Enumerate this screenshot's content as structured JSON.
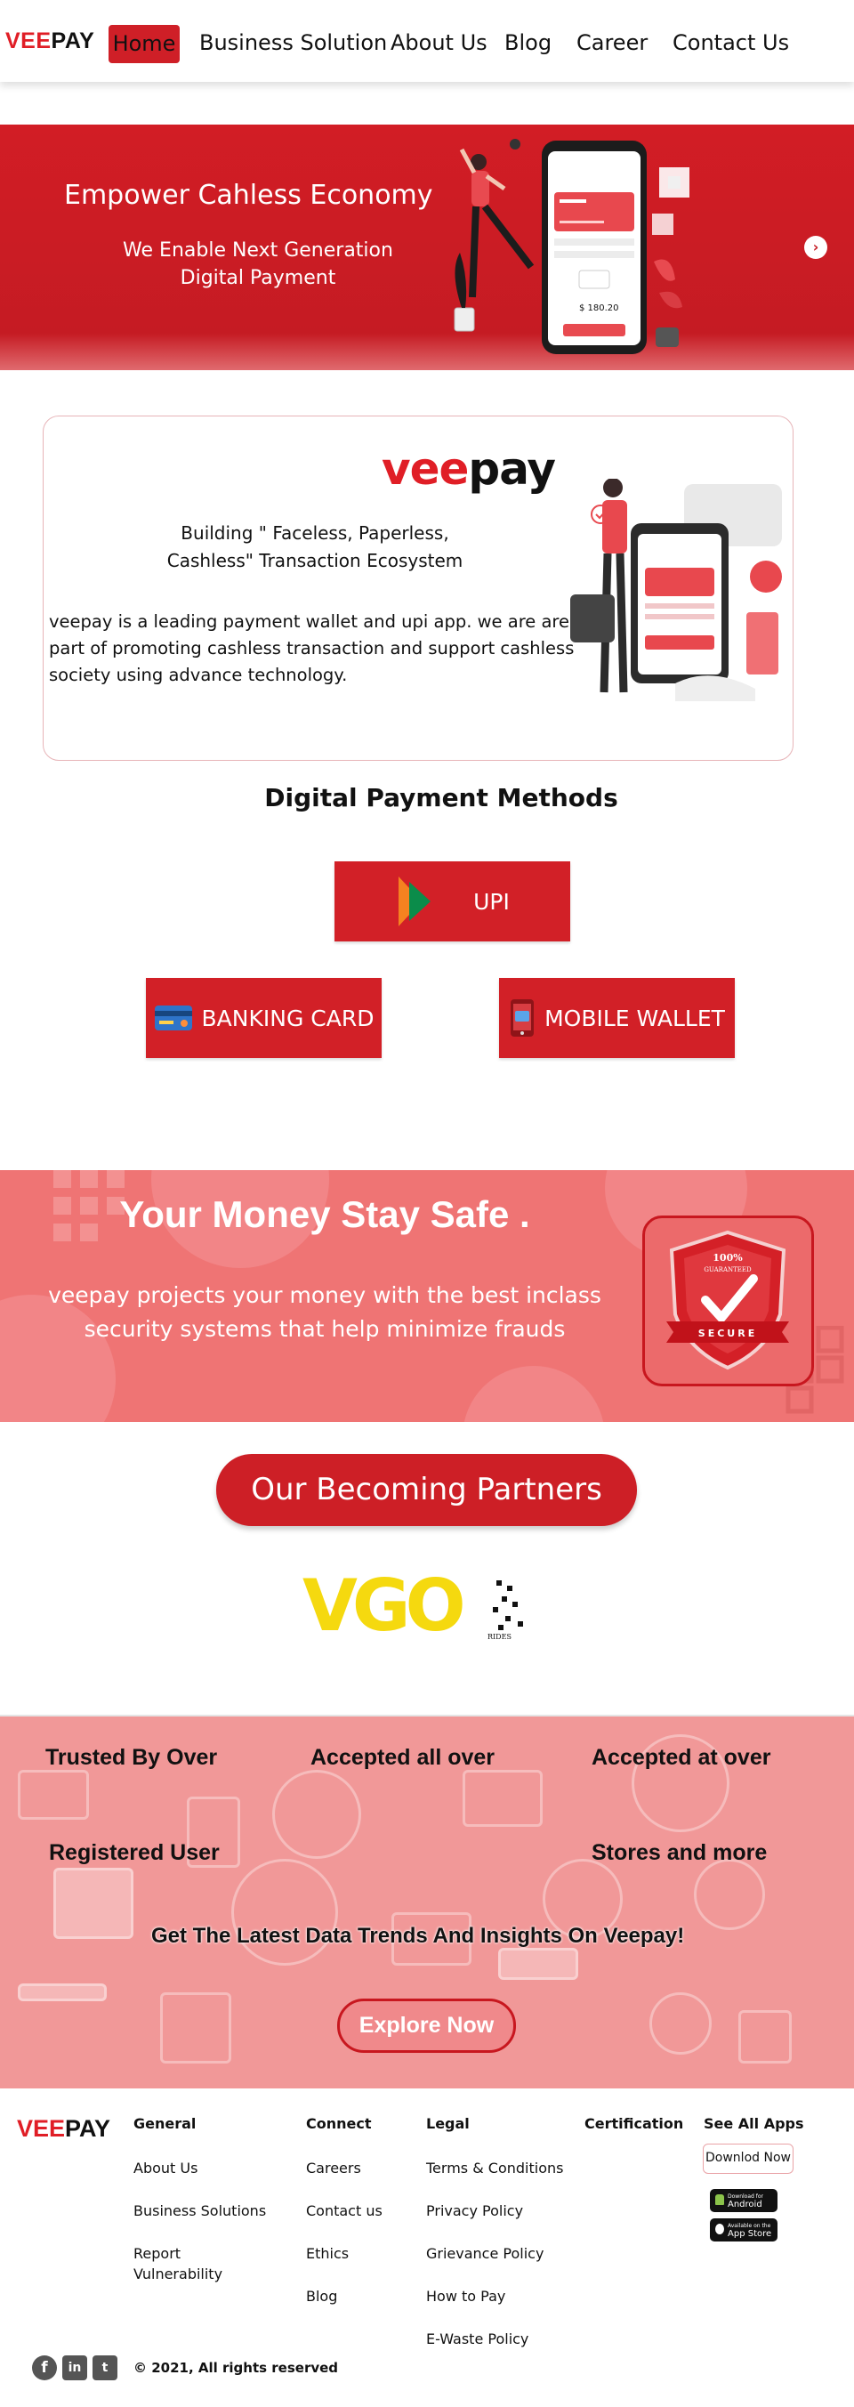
{
  "brand": {
    "name_red": "VEE",
    "name_black": "PAY",
    "accent": "#d22027"
  },
  "nav": {
    "items": [
      {
        "label": "Home",
        "active": true
      },
      {
        "label": "Business Solution"
      },
      {
        "label": "About Us"
      },
      {
        "label": "Blog"
      },
      {
        "label": "Career"
      },
      {
        "label": "Contact Us"
      }
    ]
  },
  "banner": {
    "heading": "Empower Cahless Economy",
    "subheading": "We Enable Next Generation Digital Payment",
    "next_icon": "chevron-right-icon",
    "phone": {
      "amount": "$ 180.20"
    }
  },
  "about": {
    "logo_red": "vee",
    "logo_black": "pay",
    "tagline": "Building \" Faceless, Paperless, Cashless\" Transaction  Ecosystem",
    "description": "veepay is a leading payment wallet and upi app. we are are a part of promoting cashless transaction and support cashless society using advance technology."
  },
  "methods": {
    "title": "Digital Payment Methods",
    "items": [
      {
        "label": "UPI",
        "icon": "upi-icon"
      },
      {
        "label": "BANKING CARD",
        "icon": "credit-card-icon"
      },
      {
        "label": "MOBILE WALLET",
        "icon": "mobile-wallet-icon"
      }
    ]
  },
  "safe": {
    "heading": "Your Money Stay Safe .",
    "text": "veepay projects your money with the best inclass security systems that help minimize frauds",
    "badge_top": "100%",
    "badge_mid": "GUARANTEED",
    "badge_ribbon": "SECURE"
  },
  "partners": {
    "button": "Our Becoming Partners",
    "logo_text": "VGO",
    "logo_sub": "RIDES"
  },
  "stats": {
    "labels": [
      "Trusted By Over",
      "Accepted all over",
      "Accepted at over",
      "Registered User",
      "Stores and more"
    ],
    "insight": "Get The Latest Data Trends And Insights On Veepay!",
    "explore": "Explore Now"
  },
  "footer": {
    "columns": [
      {
        "heading": "General",
        "links": [
          "About Us",
          "Business Solutions",
          "Report Vulnerability"
        ]
      },
      {
        "heading": "Connect",
        "links": [
          "Careers",
          "Contact us",
          "Ethics",
          "Blog"
        ]
      },
      {
        "heading": "Legal",
        "links": [
          "Terms & Conditions",
          "Privacy Policy",
          "Grievance Policy",
          "How to Pay",
          "E-Waste Policy"
        ]
      },
      {
        "heading": "Certification",
        "links": []
      },
      {
        "heading": "See All Apps",
        "links": []
      }
    ],
    "download": "Downlod Now",
    "android": {
      "small": "Download for",
      "big": "Android"
    },
    "appstore": {
      "small": "Available on the",
      "big": "App Store"
    },
    "copyright": "© 2021, All rights  reserved",
    "social_icons": [
      "facebook-icon",
      "linkedin-icon",
      "twitter-icon"
    ]
  }
}
